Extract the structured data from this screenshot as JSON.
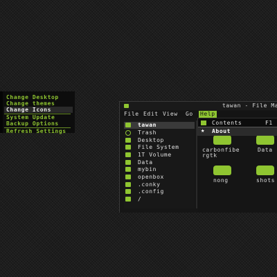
{
  "desktop_menu": {
    "items": [
      "Change Desktop",
      "Change themes",
      "Change Icons"
    ],
    "items2": [
      "System Update",
      "Backup Options"
    ],
    "items3": [
      "Refresh Settings"
    ]
  },
  "window": {
    "title": "tawan - File Ma",
    "menu": [
      "File",
      "Edit",
      "View",
      "Go",
      "Help"
    ],
    "sidebar": [
      "tawan",
      "Trash",
      "Desktop",
      "File System",
      "1T Volume",
      "Data",
      "mybin",
      "openbox",
      ".conky",
      ".config",
      "/"
    ],
    "files": [
      "carbonfibe rgtk",
      "Data",
      "nong",
      "shots"
    ]
  },
  "help_menu": {
    "contents_label": "Contents",
    "contents_accel": "F1",
    "about_label": "About"
  },
  "colors": {
    "accent": "#8fc531",
    "background": "#1d1d1d"
  }
}
